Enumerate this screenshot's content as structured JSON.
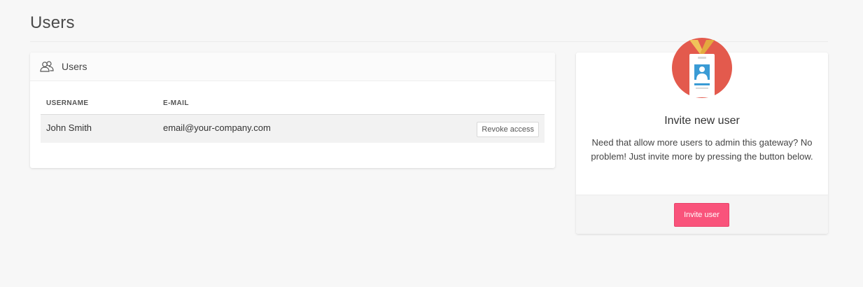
{
  "page": {
    "title": "Users"
  },
  "users_panel": {
    "icon": "users-icon",
    "title": "Users",
    "columns": [
      "USERNAME",
      "E-MAIL"
    ],
    "rows": [
      {
        "username": "John Smith",
        "email": "email@your-company.com",
        "action_label": "Revoke access"
      }
    ]
  },
  "invite_panel": {
    "icon": "id-badge-icon",
    "title": "Invite new user",
    "description": "Need that allow more users to admin this gateway? No problem! Just invite more by pressing the button below.",
    "button_label": "Invite user"
  },
  "colors": {
    "background": "#f7f7f7",
    "accent": "#f9537b",
    "badge_circle": "#e35a4d",
    "badge_lanyard": "#f0c35a",
    "badge_photo": "#3a9bd5"
  }
}
